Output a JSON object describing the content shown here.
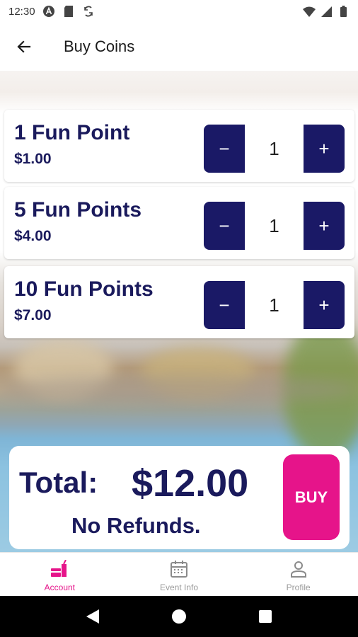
{
  "status_bar": {
    "time": "12:30",
    "icons_left": [
      "app-a-icon",
      "sd-card-icon",
      "sync-icon"
    ],
    "icons_right": [
      "wifi-icon",
      "signal-icon",
      "battery-icon"
    ]
  },
  "app_bar": {
    "back_icon": "arrow-left-icon",
    "title": "Buy Coins"
  },
  "items": [
    {
      "name": "1 Fun Point",
      "price": "$1.00",
      "quantity": "1",
      "minus": "−",
      "plus": "+"
    },
    {
      "name": "5 Fun Points",
      "price": "$4.00",
      "quantity": "1",
      "minus": "−",
      "plus": "+"
    },
    {
      "name": "10 Fun Points",
      "price": "$7.00",
      "quantity": "1",
      "minus": "−",
      "plus": "+"
    }
  ],
  "summary": {
    "total_label": "Total:",
    "total_value": "$12.00",
    "notice": "No Refunds.",
    "buy_label": "BUY"
  },
  "bottom_nav": {
    "items": [
      {
        "label": "Account",
        "icon": "food-drink-icon",
        "active": true
      },
      {
        "label": "Event Info",
        "icon": "calendar-icon",
        "active": false
      },
      {
        "label": "Profile",
        "icon": "person-icon",
        "active": false
      }
    ]
  },
  "colors": {
    "navy": "#1a1966",
    "text_navy": "#1a1a5c",
    "accent_pink": "#e6148a"
  },
  "system_nav": {
    "icons": [
      "back-triangle-icon",
      "home-circle-icon",
      "recents-square-icon"
    ]
  }
}
